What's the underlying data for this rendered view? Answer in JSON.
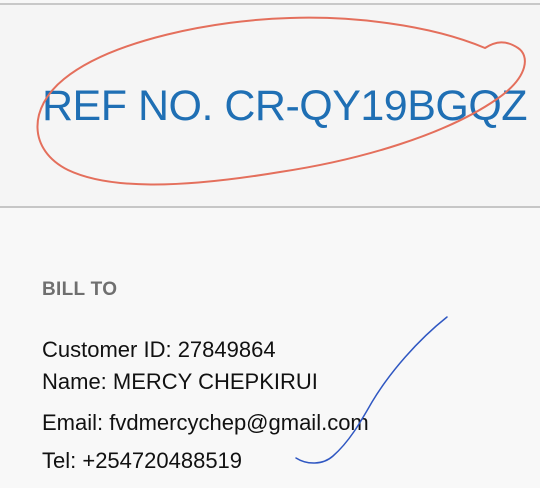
{
  "reference": {
    "label": "REF NO. CR-QY19BGQZ"
  },
  "bill_to": {
    "heading": "BILL TO",
    "customer_id": "Customer ID: 27849864",
    "name": "Name: MERCY CHEPKIRUI",
    "email": "Email: fvdmercychep@gmail.com",
    "tel": "Tel: +254720488519"
  },
  "colors": {
    "reference_text": "#1f6fb4",
    "circle_annotation": "#e46f5c",
    "pen_annotation": "#2f57c2"
  }
}
